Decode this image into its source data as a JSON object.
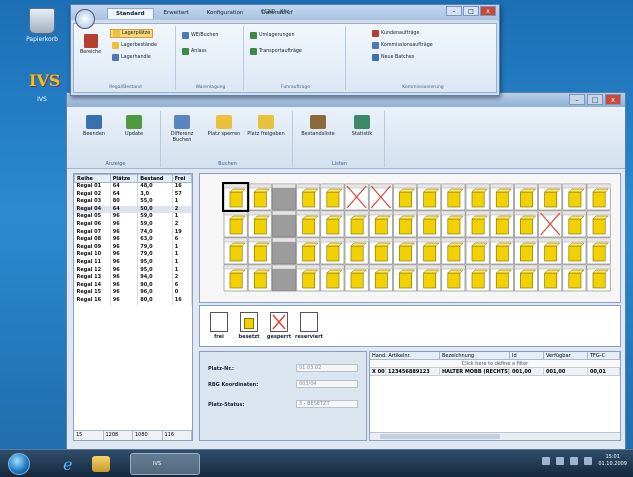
{
  "desktop": {
    "icons": [
      {
        "label": "Papierkorb"
      },
      {
        "label": "IVS"
      }
    ]
  },
  "ribbon_window": {
    "title": "CCNR - Kfiz",
    "tabs": [
      {
        "label": "Standard",
        "active": true
      },
      {
        "label": "Erweitert",
        "active": false
      },
      {
        "label": "Konfiguration",
        "active": false
      },
      {
        "label": "Datenabruf",
        "active": false
      }
    ],
    "groups": [
      {
        "caption": "Regal/Bestand",
        "items": [
          "Bereiche",
          "Lagerplätze",
          "Lagerbestände",
          "Lagerhandle"
        ]
      },
      {
        "caption": "Warenlagung",
        "items": [
          "WE/Buchen",
          "Anlass"
        ]
      },
      {
        "caption": "Fuhrauftrage",
        "items": [
          "Umlagerungen",
          "Transportaufträge"
        ]
      },
      {
        "caption": "Kommissionierung",
        "items": [
          "Kundenaufträge",
          "Kommissionsaufträge",
          "Neue Batches"
        ]
      }
    ]
  },
  "toolbar": {
    "groups": [
      {
        "caption": "Anzeige",
        "buttons": [
          "Beenden",
          "Update"
        ]
      },
      {
        "caption": "Buchen",
        "buttons": [
          "Differenz Buchen",
          "Platz sperren",
          "Platz freigeben"
        ]
      },
      {
        "caption": "Listen",
        "buttons": [
          "Bestandsliste",
          "Statistik"
        ]
      }
    ]
  },
  "racks": {
    "headers": [
      "Reihe",
      "Plätze",
      "Bestand",
      "Frei"
    ],
    "rows": [
      [
        "Regal 01",
        "64",
        "48,0",
        "16"
      ],
      [
        "Regal 02",
        "64",
        "3,0",
        "57"
      ],
      [
        "Regal 03",
        "80",
        "55,0",
        "1"
      ],
      [
        "Regal 04",
        "64",
        "50,0",
        "2"
      ],
      [
        "Regal 05",
        "96",
        "59,0",
        "1"
      ],
      [
        "Regal 06",
        "96",
        "59,0",
        "2"
      ],
      [
        "Regal 07",
        "96",
        "74,0",
        "19"
      ],
      [
        "Regal 08",
        "96",
        "63,0",
        "6"
      ],
      [
        "Regal 09",
        "96",
        "79,0",
        "1"
      ],
      [
        "Regal 10",
        "96",
        "79,0",
        "1"
      ],
      [
        "Regal 11",
        "96",
        "95,0",
        "1"
      ],
      [
        "Regal 12",
        "96",
        "95,0",
        "1"
      ],
      [
        "Regal 13",
        "96",
        "94,0",
        "2"
      ],
      [
        "Regal 14",
        "96",
        "90,0",
        "6"
      ],
      [
        "Regal 15",
        "96",
        "96,0",
        "0"
      ],
      [
        "Regal 16",
        "96",
        "80,0",
        "16"
      ]
    ],
    "selected_index": 3,
    "footer": [
      "15",
      "1208",
      "1080",
      "116"
    ]
  },
  "legend": [
    {
      "label": "frei"
    },
    {
      "label": "besetzt"
    },
    {
      "label": "gesperrt"
    },
    {
      "label": "reserviert"
    }
  ],
  "form": {
    "fields": [
      {
        "label": "Platz-Nr.:",
        "value": "01.03.02"
      },
      {
        "label": "RBG Koordinaten:",
        "value": "003/04"
      },
      {
        "label": "Platz-Status:",
        "value": "3 - BESETZT"
      }
    ]
  },
  "table": {
    "headers": [
      "E",
      "Hand. Artikelnr.",
      "Bezeichnung",
      "Id",
      "Verfügbar",
      "TFG-C"
    ],
    "filter_text": "Click here to define a filter",
    "rows": [
      [
        "X 00",
        "123456889123",
        "HALTER MOBB (RECHTS)",
        "001,00",
        "001,00",
        "00,01"
      ]
    ]
  },
  "taskbar": {
    "app_label": "IVS",
    "clock_time": "15:01",
    "clock_date": "01.10.2009"
  },
  "colors": {
    "occupied": "#f2d100",
    "free": "#ffffff",
    "blocked_cross": "#d8473a",
    "reserved": "#9c9c9c"
  }
}
